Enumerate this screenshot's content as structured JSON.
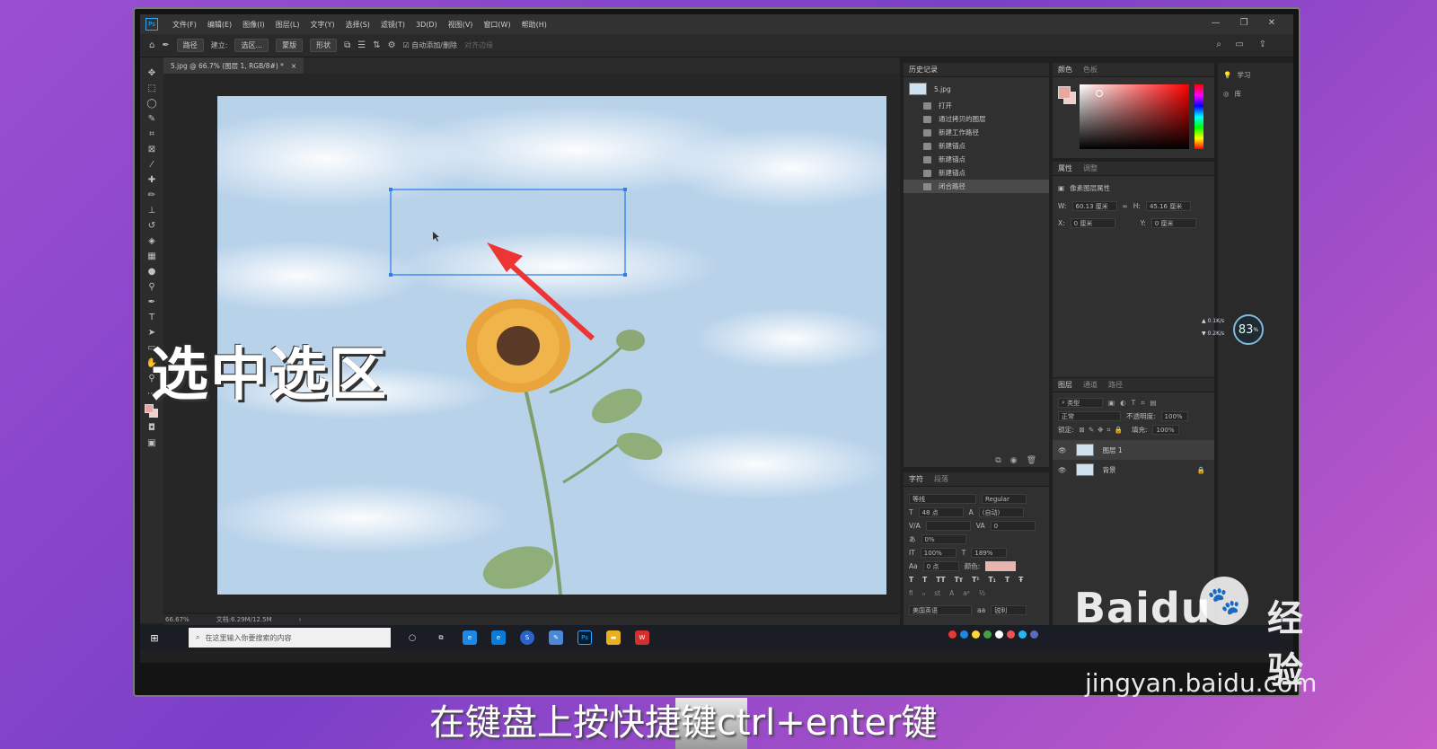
{
  "app": {
    "logo": "Ps"
  },
  "menus": [
    "文件(F)",
    "编辑(E)",
    "图像(I)",
    "图层(L)",
    "文字(Y)",
    "选择(S)",
    "滤镜(T)",
    "3D(D)",
    "视图(V)",
    "窗口(W)",
    "帮助(H)"
  ],
  "window_controls": [
    "—",
    "❐",
    "✕"
  ],
  "options": {
    "mode": "路径",
    "make_label": "建立:",
    "selection_btn": "选区...",
    "mask_btn": "蒙版",
    "shape_btn": "形状",
    "auto_add": "自动添加/删除",
    "align_edges": "对齐边缘"
  },
  "document": {
    "tab": "5.jpg @ 66.7% (图层 1, RGB/8#) *",
    "close": "×"
  },
  "status": {
    "zoom": "66.67%",
    "docsize": "文档:6.29M/12.5M",
    "arrow": "›"
  },
  "history": {
    "tabs": [
      "历史记录"
    ],
    "snapshot": "5.jpg",
    "items": [
      "打开",
      "通过拷贝的图层",
      "新建工作路径",
      "新建锚点",
      "新建锚点",
      "新建锚点",
      "闭合路径"
    ]
  },
  "color": {
    "tabs": [
      "颜色",
      "色板"
    ],
    "fg": "#e8a8a0",
    "bg": "#f0d0cc"
  },
  "properties": {
    "tabs": [
      "属性",
      "调整"
    ],
    "title": "像素图层属性",
    "w_label": "W:",
    "w": "60.13 厘米",
    "h_label": "H:",
    "h": "45.16 厘米",
    "x_label": "X:",
    "x": "0 厘米",
    "y_label": "Y:",
    "y": "0 厘米"
  },
  "learn": {
    "label": "学习",
    "libs": "库"
  },
  "character": {
    "tabs": [
      "字符",
      "段落"
    ],
    "font": "等线",
    "style": "Regular",
    "size": "48 点",
    "leading": "(自动)",
    "kern": "0",
    "scale_pct": "0%",
    "vscale": "100%",
    "hscale": "189%",
    "baseline": "0 点",
    "color_label": "颜色:",
    "lang": "美国英语",
    "aa": "锐利"
  },
  "layers": {
    "tabs": [
      "图层",
      "通道",
      "路径"
    ],
    "filter": "类型",
    "blend": "正常",
    "opacity_label": "不透明度:",
    "opacity": "100%",
    "lock_label": "锁定:",
    "fill_label": "填充:",
    "fill": "100%",
    "items": [
      {
        "name": "图层 1"
      },
      {
        "name": "背景"
      }
    ]
  },
  "memory": {
    "pct": "83",
    "unit": "%",
    "up": "0.1",
    "down": "0.2",
    "rate": "K/s"
  },
  "taskbar": {
    "search": "在这里输入你要搜索的内容",
    "ps": "Ps"
  },
  "overlay": {
    "title": "选中选区",
    "subtitle": "在键盘上按快捷键ctrl+enter键"
  },
  "watermark": {
    "baidu": "Baidu",
    "jingyan": "经验",
    "url": "jingyan.baidu.com"
  },
  "accent": "#ee3535"
}
